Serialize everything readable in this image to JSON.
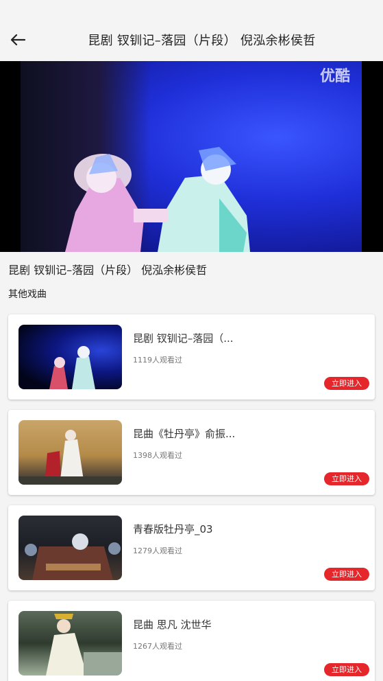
{
  "app_bar": {
    "title": "昆剧 钗钏记–落园（片段） 倪泓余彬侯哲",
    "back_icon": "arrow-left-icon"
  },
  "player": {
    "watermark": "优酷"
  },
  "video_title": "昆剧 钗钏记–落园（片段） 倪泓余彬侯哲",
  "section_label": "其他戏曲",
  "items": [
    {
      "title": "昆剧 钗钏记–落园（...",
      "views": "1119人观看过",
      "button": "立即进入"
    },
    {
      "title": "昆曲《牡丹亭》俞振...",
      "views": "1398人观看过",
      "button": "立即进入"
    },
    {
      "title": "青春版牡丹亭_03",
      "views": "1279人观看过",
      "button": "立即进入"
    },
    {
      "title": "昆曲 思凡 沈世华",
      "views": "1267人观看过",
      "button": "立即进入"
    }
  ],
  "colors": {
    "accent": "#e5262a",
    "background": "#f4f4f4"
  }
}
